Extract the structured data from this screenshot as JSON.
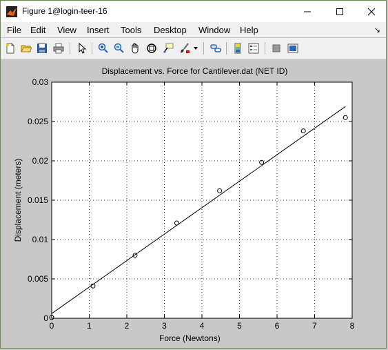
{
  "window": {
    "title": "Figure 1@login-teer-16"
  },
  "menu": {
    "file": "File",
    "edit": "Edit",
    "view": "View",
    "insert": "Insert",
    "tools": "Tools",
    "desktop": "Desktop",
    "window": "Window",
    "help": "Help"
  },
  "toolbar": {
    "icons": [
      "new-figure-icon",
      "open-icon",
      "save-icon",
      "print-icon",
      "edit-plot-arrow-icon",
      "zoom-in-icon",
      "zoom-out-icon",
      "pan-icon",
      "rotate-3d-icon",
      "data-cursor-icon",
      "brush-icon",
      "link-icon",
      "colorbar-icon",
      "legend-icon",
      "hide-plot-tools-icon",
      "show-plot-tools-icon"
    ]
  },
  "chart_data": {
    "type": "scatter",
    "title": "Displacement vs. Force for Cantilever.dat (NET ID)",
    "xlabel": "Force (Newtons)",
    "ylabel": "Displacement (meters)",
    "xlim": [
      0,
      8
    ],
    "ylim": [
      0,
      0.03
    ],
    "xticks": [
      "0",
      "1",
      "2",
      "3",
      "4",
      "5",
      "6",
      "7",
      "8"
    ],
    "yticks": [
      "0",
      "0.005",
      "0.01",
      "0.015",
      "0.02",
      "0.025",
      "0.03"
    ],
    "grid": true,
    "series": [
      {
        "style": "markers",
        "x": [
          0,
          1.1,
          2.22,
          3.33,
          4.47,
          5.59,
          6.7,
          7.82
        ],
        "y": [
          0.0001,
          0.0041,
          0.008,
          0.0121,
          0.0162,
          0.0198,
          0.0238,
          0.0255
        ]
      },
      {
        "style": "line",
        "x": [
          0,
          7.82
        ],
        "y": [
          0.0006,
          0.0269
        ]
      }
    ]
  }
}
